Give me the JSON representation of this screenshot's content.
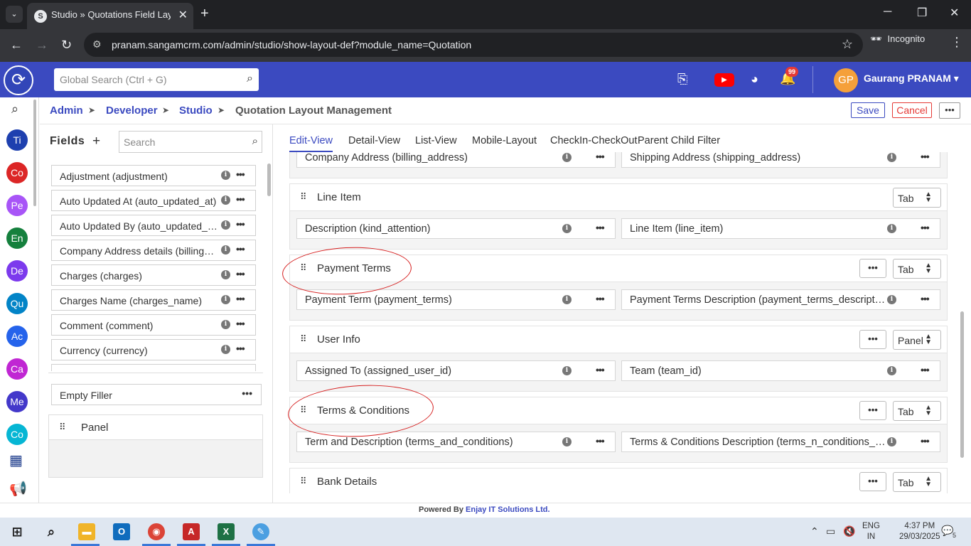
{
  "browser": {
    "tab_title": "Studio » Quotations Field Layout",
    "url": "pranam.sangamcrm.com/admin/studio/show-layout-def?module_name=Quotation",
    "mode": "Incognito"
  },
  "header": {
    "search_placeholder": "Global Search (Ctrl + G)",
    "notification_count": "99",
    "avatar_initials": "GP",
    "user_name": "Gaurang PRANAM",
    "accent_color": "#3b4ac0"
  },
  "rail": {
    "items": [
      {
        "abbr": "Ti",
        "color": "#1e40af"
      },
      {
        "abbr": "Co",
        "color": "#dc2626"
      },
      {
        "abbr": "Pe",
        "color": "#a855f7"
      },
      {
        "abbr": "En",
        "color": "#15803d"
      },
      {
        "abbr": "De",
        "color": "#7c3aed"
      },
      {
        "abbr": "Qu",
        "color": "#0284c7"
      },
      {
        "abbr": "Ac",
        "color": "#2563eb"
      },
      {
        "abbr": "Ca",
        "color": "#c026d3"
      },
      {
        "abbr": "Me",
        "color": "#4338ca"
      },
      {
        "abbr": "Co",
        "color": "#06b6d4"
      }
    ]
  },
  "breadcrumb": {
    "items": [
      "Admin",
      "Developer",
      "Studio"
    ],
    "current": "Quotation Layout Management"
  },
  "actions": {
    "save": "Save",
    "cancel": "Cancel"
  },
  "fields_panel": {
    "title": "Fields",
    "search_placeholder": "Search",
    "items": [
      "Adjustment (adjustment)",
      "Auto Updated At (auto_updated_at)",
      "Auto Updated By (auto_updated_by)",
      "Company Address details (billing_address_details)",
      "Charges (charges)",
      "Charges Name (charges_name)",
      "Comment (comment)",
      "Currency (currency)"
    ],
    "empty_filler": "Empty Filler",
    "panel_label": "Panel"
  },
  "main_tabs": [
    "Edit-View",
    "Detail-View",
    "List-View",
    "Mobile-Layout",
    "CheckIn-CheckOut",
    "Parent Child Filter"
  ],
  "sections": [
    {
      "title": "",
      "type": "",
      "left": "Company Address (billing_address)",
      "right": "Shipping Address (shipping_address)"
    },
    {
      "title": "Line Item",
      "type": "Tab",
      "left": "Description (kind_attention)",
      "right": "Line Item (line_item)"
    },
    {
      "title": "Payment Terms",
      "type": "Tab",
      "left": "Payment Term (payment_terms)",
      "right": "Payment Terms Description (payment_terms_description)"
    },
    {
      "title": "User Info",
      "type": "Panel",
      "left": "Assigned To (assigned_user_id)",
      "right": "Team (team_id)"
    },
    {
      "title": "Terms & Conditions",
      "type": "Tab",
      "left": "Term and Description (terms_and_conditions)",
      "right": "Terms & Conditions Description (terms_n_conditions_description)"
    },
    {
      "title": "Bank Details",
      "type": "Tab",
      "left": "",
      "right": ""
    }
  ],
  "footer": {
    "prefix": "Powered By",
    "company": "Enjay IT Solutions Ltd."
  },
  "taskbar": {
    "lang": "ENG",
    "region": "IN",
    "time": "4:37 PM",
    "date": "29/03/2025",
    "notif_count": "5"
  }
}
